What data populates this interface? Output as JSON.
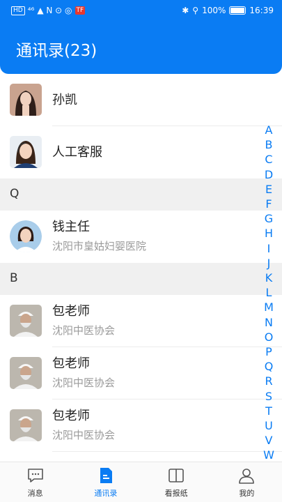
{
  "status_bar": {
    "left_chip": "HD",
    "signal": "⁴⁶",
    "left_icons": "▲ N ⊙ ◎",
    "app_badge": "TF",
    "battery_pct": "100%",
    "time": "16:39"
  },
  "header": {
    "title": "通讯录(23)"
  },
  "contacts": [
    {
      "name": "孙凯",
      "subtitle": ""
    },
    {
      "name": "人工客服",
      "subtitle": ""
    },
    {
      "name": "钱主任",
      "subtitle": "沈阳市皇姑妇婴医院"
    },
    {
      "name": "包老师",
      "subtitle": "沈阳中医协会"
    },
    {
      "name": "包老师",
      "subtitle": "沈阳中医协会"
    },
    {
      "name": "包老师",
      "subtitle": "沈阳中医协会"
    }
  ],
  "sections": [
    "Q",
    "B"
  ],
  "index_letters": [
    "A",
    "B",
    "C",
    "D",
    "E",
    "F",
    "G",
    "H",
    "I",
    "J",
    "K",
    "L",
    "M",
    "N",
    "O",
    "P",
    "Q",
    "R",
    "S",
    "T",
    "U",
    "V",
    "W"
  ],
  "tabs": [
    {
      "label": "消息",
      "icon": "message-icon"
    },
    {
      "label": "通讯录",
      "icon": "contacts-icon"
    },
    {
      "label": "看报纸",
      "icon": "book-icon"
    },
    {
      "label": "我的",
      "icon": "profile-icon"
    }
  ],
  "colors": {
    "accent": "#0a7cf3",
    "section_bg": "#f0f0f0"
  }
}
